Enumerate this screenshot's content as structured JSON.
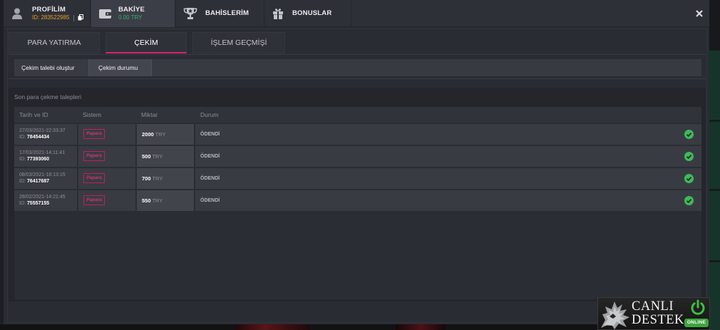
{
  "header": {
    "tabs": [
      {
        "label": "PROFİLİM",
        "sub": "ID: 283522985",
        "icon": "user-icon"
      },
      {
        "label": "BAKİYE",
        "sub": "0.00 TRY",
        "icon": "wallet-icon",
        "active": true
      },
      {
        "label": "BAHİSLERİM",
        "icon": "trophy-icon"
      },
      {
        "label": "BONUSLAR",
        "icon": "gift-icon"
      }
    ],
    "copy_icon": "copy-icon",
    "close_icon": "close-icon"
  },
  "nav": {
    "tabs": [
      {
        "label": "PARA YATIRMA"
      },
      {
        "label": "ÇEKİM",
        "active": true
      },
      {
        "label": "İŞLEM GEÇMİŞİ"
      }
    ]
  },
  "subnav": {
    "tabs": [
      {
        "label": "Çekim talebi oluştur"
      },
      {
        "label": "Çekim durumu",
        "active": true
      }
    ]
  },
  "withdrawals": {
    "title": "Son para çekme talepleri",
    "columns": [
      "Tarih ve ID",
      "Sistem",
      "Miktar",
      "Durum"
    ],
    "id_label": "ID:",
    "status_icon": "check-circle-icon",
    "rows": [
      {
        "date": "27/03/2021-22:33:37",
        "id": "78454434",
        "system": "Papara",
        "amount": "2000",
        "currency": "TRY",
        "status": "ÖDENDİ"
      },
      {
        "date": "17/03/2021-14:11:41",
        "id": "77393060",
        "system": "Papara",
        "amount": "500",
        "currency": "TRY",
        "status": "ÖDENDİ"
      },
      {
        "date": "08/03/2021-18:13:15",
        "id": "76417687",
        "system": "Papara",
        "amount": "700",
        "currency": "TRY",
        "status": "ÖDENDİ"
      },
      {
        "date": "28/02/2021-14:21:45",
        "id": "75557155",
        "system": "Papara",
        "amount": "550",
        "currency": "TRY",
        "status": "ÖDENDİ"
      }
    ]
  },
  "support": {
    "line1": "CANLI",
    "line2": "DESTEK",
    "status": "ONLINE",
    "icon": "power-icon",
    "logo": "wolf-logo"
  },
  "colors": {
    "accent": "#d6246e",
    "id_text": "#e5a11c",
    "balance_text": "#2fb36a",
    "paid_check": "#3dba5a",
    "online": "#3da53d"
  }
}
